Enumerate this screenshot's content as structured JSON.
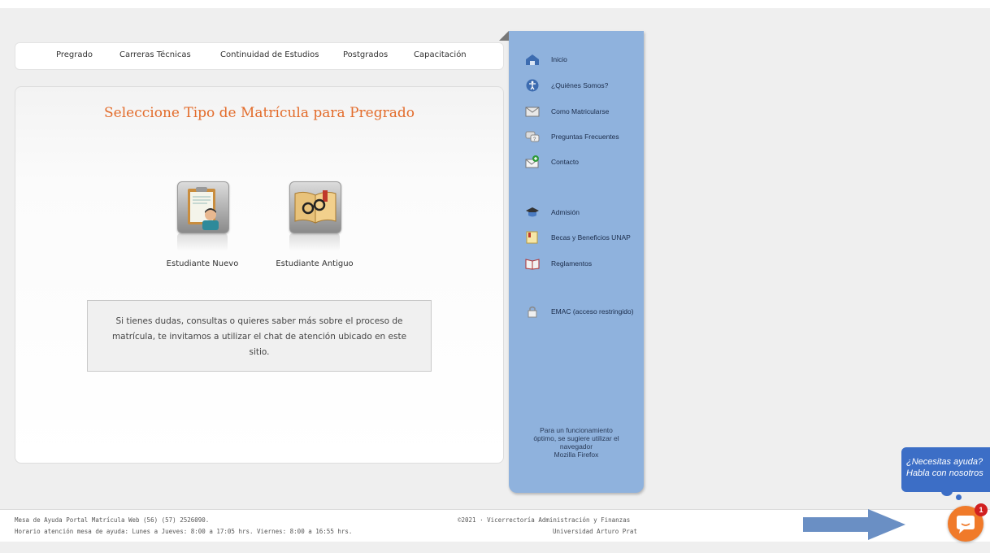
{
  "topnav": {
    "items": [
      {
        "label": "Pregrado"
      },
      {
        "label": "Carreras Técnicas"
      },
      {
        "label": "Continuidad de Estudios"
      },
      {
        "label": "Postgrados"
      },
      {
        "label": "Capacitación"
      }
    ]
  },
  "main": {
    "title": "Seleccione Tipo de Matrícula para Pregrado",
    "options": [
      {
        "label": "Estudiante Nuevo",
        "icon": "clipboard-student-icon"
      },
      {
        "label": "Estudiante Antiguo",
        "icon": "book-glasses-icon"
      }
    ],
    "info_text": "Si tienes dudas, consultas o quieres saber más sobre el proceso de matrícula, te invitamos a utilizar el chat de atención ubicado en este sitio."
  },
  "sidebar": {
    "items": [
      {
        "label": "Inicio",
        "icon": "home-icon"
      },
      {
        "label": "¿Quiénes Somos?",
        "icon": "accessibility-icon"
      },
      {
        "label": "Como Matricularse",
        "icon": "envelope-icon"
      },
      {
        "label": "Preguntas Frecuentes",
        "icon": "chat-question-icon"
      },
      {
        "label": "Contacto",
        "icon": "mail-add-icon"
      },
      {
        "label": "Admisión",
        "icon": "graduation-icon"
      },
      {
        "label": "Becas y Beneficios UNAP",
        "icon": "certificate-icon"
      },
      {
        "label": "Reglamentos",
        "icon": "open-book-icon"
      },
      {
        "label": "EMAC (acceso restringido)",
        "icon": "lock-icon"
      }
    ],
    "note_lines": [
      "Para un funcionamiento",
      "óptimo, se sugiere utilizar el",
      "navegador",
      "Mozilla Firefox"
    ]
  },
  "footer": {
    "help_line1": "Mesa de Ayuda Portal Matrícula Web (56) (57) 2526090.",
    "help_line2": "Horario atención mesa de ayuda: Lunes a Jueves: 8:00 a 17:05 hrs. Viernes: 8:00 a 16:55 hrs.",
    "copyright_line1": "©2021 · Vicerrectoría Administración y Finanzas",
    "copyright_line2": "Universidad Arturo Prat"
  },
  "chat": {
    "bubble_line1": "¿Necesitas ayuda?",
    "bubble_line2": "Habla con nosotros",
    "badge_count": "1"
  },
  "colors": {
    "accent_title": "#e36c2b",
    "sidebar_bg": "#8fb2dd",
    "chat_blue": "#3c6ec6",
    "chat_orange": "#f07a2a"
  }
}
